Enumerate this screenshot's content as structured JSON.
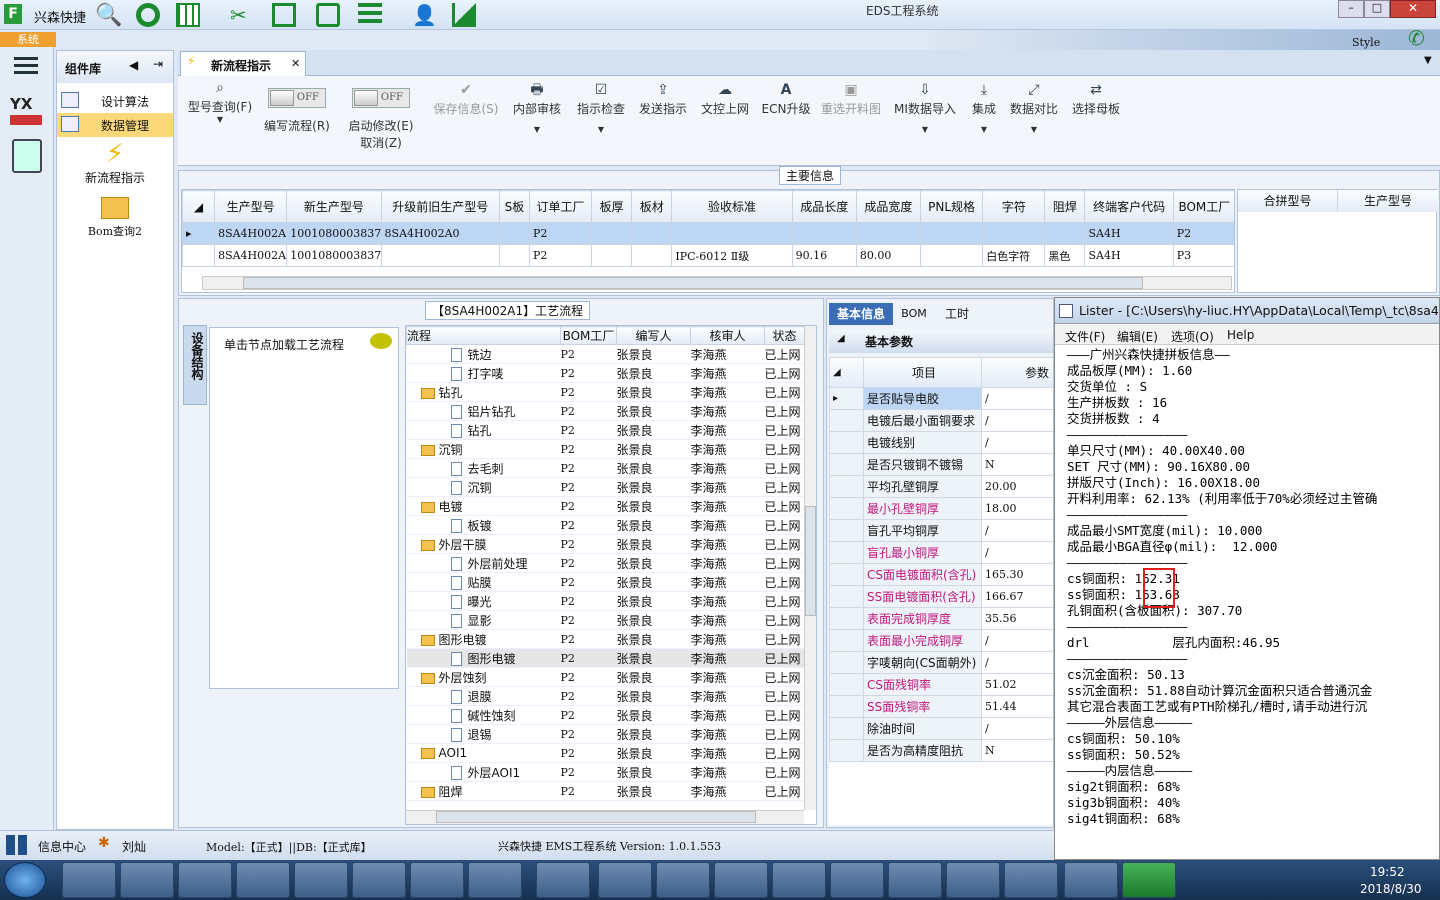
{
  "titlebar": {
    "company": "兴森快捷",
    "app_title": "EDS工程系统",
    "style_label": "Style"
  },
  "sys_label": "系统",
  "sidebar": {
    "header": "组件库",
    "items": [
      {
        "label": "设计算法"
      },
      {
        "label": "数据管理"
      }
    ],
    "tools": [
      {
        "label": "新流程指示"
      },
      {
        "label": "Bom查询2"
      }
    ]
  },
  "tab": {
    "label": "新流程指示"
  },
  "ribbon": {
    "btns": [
      {
        "label": "型号查询(F)",
        "icon": "search-icon"
      },
      {
        "label": "编写流程(R)",
        "toggle": "OFF"
      },
      {
        "label": "启动修改(E)",
        "toggle": "OFF",
        "label2": "取消(Z)"
      },
      {
        "label": "保存信息(S)",
        "icon": "check-icon"
      },
      {
        "label": "内部审核",
        "icon": "print-icon"
      },
      {
        "label": "指示检查",
        "icon": "check-icon"
      },
      {
        "label": "发送指示",
        "icon": "upload-icon"
      },
      {
        "label": "文控上网",
        "icon": "cloud-icon"
      },
      {
        "label": "ECN升级",
        "icon": "letter-a-icon"
      },
      {
        "label": "重选开料图",
        "icon": "image-icon"
      },
      {
        "label": "MI数据导入",
        "icon": "download-icon"
      },
      {
        "label": "集成",
        "icon": "download-icon"
      },
      {
        "label": "数据对比",
        "icon": "compare-icon"
      },
      {
        "label": "选择母板",
        "icon": "shuffle-icon"
      }
    ]
  },
  "main_info": {
    "title": "主要信息",
    "headers": [
      "生产型号",
      "新生产型号",
      "升级前旧生产型号",
      "S板",
      "订单工厂",
      "板厚",
      "板材",
      "验收标准",
      "成品长度",
      "成品宽度",
      "PNL规格",
      "字符",
      "阻焊",
      "终端客户代码",
      "BOM工厂"
    ],
    "rows": [
      [
        "8SA4H002A1",
        "10010800038375",
        "8SA4H002A0",
        "",
        "P2",
        "",
        "",
        "",
        "",
        "",
        "",
        "",
        "",
        "SA4H",
        "P2"
      ],
      [
        "8SA4H002A0",
        "10010800038375",
        "",
        "",
        "P2",
        "",
        "",
        "IPC-6012 Ⅱ级",
        "90.16",
        "80.00",
        "",
        "白色字符",
        "黑色",
        "SA4H",
        "P3"
      ]
    ],
    "side_headers": [
      "合拼型号",
      "生产型号"
    ]
  },
  "process": {
    "title": "【8SA4H002A1】工艺流程",
    "side_tab": "设备结构",
    "node_hint": "单击节点加载工艺流程",
    "headers": [
      "流程",
      "BOM工厂",
      "编写人",
      "核审人",
      "状态"
    ],
    "rows": [
      {
        "level": 2,
        "name": "铣边",
        "f": "P2",
        "w": "张景良",
        "r": "李海燕",
        "s": "已上网"
      },
      {
        "level": 2,
        "name": "打字唛",
        "f": "P2",
        "w": "张景良",
        "r": "李海燕",
        "s": "已上网"
      },
      {
        "level": 1,
        "name": "钻孔",
        "f": "P2",
        "w": "张景良",
        "r": "李海燕",
        "s": "已上网"
      },
      {
        "level": 2,
        "name": "铝片钻孔",
        "f": "P2",
        "w": "张景良",
        "r": "李海燕",
        "s": "已上网"
      },
      {
        "level": 2,
        "name": "钻孔",
        "f": "P2",
        "w": "张景良",
        "r": "李海燕",
        "s": "已上网"
      },
      {
        "level": 1,
        "name": "沉铜",
        "f": "P2",
        "w": "张景良",
        "r": "李海燕",
        "s": "已上网"
      },
      {
        "level": 2,
        "name": "去毛刺",
        "f": "P2",
        "w": "张景良",
        "r": "李海燕",
        "s": "已上网"
      },
      {
        "level": 2,
        "name": "沉铜",
        "f": "P2",
        "w": "张景良",
        "r": "李海燕",
        "s": "已上网"
      },
      {
        "level": 1,
        "name": "电镀",
        "f": "P2",
        "w": "张景良",
        "r": "李海燕",
        "s": "已上网"
      },
      {
        "level": 2,
        "name": "板镀",
        "f": "P2",
        "w": "张景良",
        "r": "李海燕",
        "s": "已上网"
      },
      {
        "level": 1,
        "name": "外层干膜",
        "f": "P2",
        "w": "张景良",
        "r": "李海燕",
        "s": "已上网"
      },
      {
        "level": 2,
        "name": "外层前处理",
        "f": "P2",
        "w": "张景良",
        "r": "李海燕",
        "s": "已上网"
      },
      {
        "level": 2,
        "name": "贴膜",
        "f": "P2",
        "w": "张景良",
        "r": "李海燕",
        "s": "已上网"
      },
      {
        "level": 2,
        "name": "曝光",
        "f": "P2",
        "w": "张景良",
        "r": "李海燕",
        "s": "已上网"
      },
      {
        "level": 2,
        "name": "显影",
        "f": "P2",
        "w": "张景良",
        "r": "李海燕",
        "s": "已上网"
      },
      {
        "level": 1,
        "name": "图形电镀",
        "f": "P2",
        "w": "张景良",
        "r": "李海燕",
        "s": "已上网"
      },
      {
        "level": 2,
        "name": "图形电镀",
        "f": "P2",
        "w": "张景良",
        "r": "李海燕",
        "s": "已上网"
      },
      {
        "level": 1,
        "name": "外层蚀刻",
        "f": "P2",
        "w": "张景良",
        "r": "李海燕",
        "s": "已上网"
      },
      {
        "level": 2,
        "name": "退膜",
        "f": "P2",
        "w": "张景良",
        "r": "李海燕",
        "s": "已上网"
      },
      {
        "level": 2,
        "name": "碱性蚀刻",
        "f": "P2",
        "w": "张景良",
        "r": "李海燕",
        "s": "已上网"
      },
      {
        "level": 2,
        "name": "退锡",
        "f": "P2",
        "w": "张景良",
        "r": "李海燕",
        "s": "已上网"
      },
      {
        "level": 1,
        "name": "AOI1",
        "f": "P2",
        "w": "张景良",
        "r": "李海燕",
        "s": "已上网"
      },
      {
        "level": 2,
        "name": "外层AOI1",
        "f": "P2",
        "w": "张景良",
        "r": "李海燕",
        "s": "已上网"
      },
      {
        "level": 1,
        "name": "阻焊",
        "f": "P2",
        "w": "张景良",
        "r": "李海燕",
        "s": "已上网"
      }
    ]
  },
  "basic": {
    "tabs": [
      "基本信息",
      "BOM",
      "工时"
    ],
    "group": "基本参数",
    "col_item": "项目",
    "col_param": "参数",
    "rows": [
      {
        "k": "是否贴导电胶",
        "v": "/",
        "pink": false
      },
      {
        "k": "电镀后最小面铜要求",
        "v": "/",
        "pink": false
      },
      {
        "k": "电镀线别",
        "v": "/",
        "pink": false
      },
      {
        "k": "是否只镀铜不镀锡",
        "v": "N",
        "pink": false
      },
      {
        "k": "平均孔壁铜厚",
        "v": "20.00",
        "pink": false
      },
      {
        "k": "最小孔壁铜厚",
        "v": "18.00",
        "pink": true
      },
      {
        "k": "盲孔平均铜厚",
        "v": "/",
        "pink": false
      },
      {
        "k": "盲孔最小铜厚",
        "v": "/",
        "pink": true
      },
      {
        "k": "CS面电镀面积(含孔)",
        "v": "165.30",
        "pink": true
      },
      {
        "k": "SS面电镀面积(含孔)",
        "v": "166.67",
        "pink": true
      },
      {
        "k": "表面完成铜厚度",
        "v": "35.56",
        "pink": true
      },
      {
        "k": "表面最小完成铜厚",
        "v": "/",
        "pink": true
      },
      {
        "k": "字唛朝向(CS面朝外)",
        "v": "/",
        "pink": false
      },
      {
        "k": "CS面残铜率",
        "v": "51.02",
        "pink": true
      },
      {
        "k": "SS面残铜率",
        "v": "51.44",
        "pink": true
      },
      {
        "k": "除油时间",
        "v": "/",
        "pink": false
      },
      {
        "k": "是否为高精度阻抗",
        "v": "N",
        "pink": false
      }
    ]
  },
  "lister": {
    "title": "Lister - [C:\\Users\\hy-liuc.HY\\AppData\\Local\\Temp\\_tc\\8sa4h00",
    "menu": [
      "文件(F)",
      "编辑(E)",
      "选项(O)",
      "Help"
    ],
    "lines": [
      "———广州兴森快捷拼板信息——",
      "成品板厚(MM): 1.60",
      "交货单位 : S",
      "生产拼板数 : 16",
      "交货拼板数 : 4",
      "————————————————",
      "单只尺寸(MM): 40.00X40.00",
      "SET 尺寸(MM): 90.16X80.00",
      "拼版尺寸(Inch): 16.00X18.00",
      "开料利用率: 62.13% (利用率低于70%必须经过主管确",
      "————————————————",
      "成品最小SMT宽度(mil): 10.000",
      "成品最小BGA直径φ(mil):  12.000",
      "————————————————",
      "cs铜面积: 162.31",
      "ss铜面积: 163.68",
      "孔铜面积(含板面积): 307.70",
      "",
      "————————————————",
      "drl           层孔内面积:46.95",
      "",
      "————————————————",
      "cs沉金面积: 50.13",
      "ss沉金面积: 51.88自动计算沉金面积只适合普通沉金",
      "其它混合表面工艺或有PTH阶梯孔/槽时,请手动进行沉",
      "—————外层信息—————",
      "cs铜面积: 50.10%",
      "ss铜面积: 50.52%",
      "—————内层信息—————",
      "sig2t铜面积: 68%",
      "sig3b铜面积: 40%",
      "sig4t铜面积: 68%"
    ]
  },
  "status": {
    "info_center": "信息中心",
    "user": "刘灿",
    "model": "Model:【正式】||DB:【正式库】",
    "version": "兴森快捷 EMS工程系统 Version: 1.0.1.553"
  },
  "clock": {
    "time": "19:52",
    "date": "2018/8/30"
  }
}
